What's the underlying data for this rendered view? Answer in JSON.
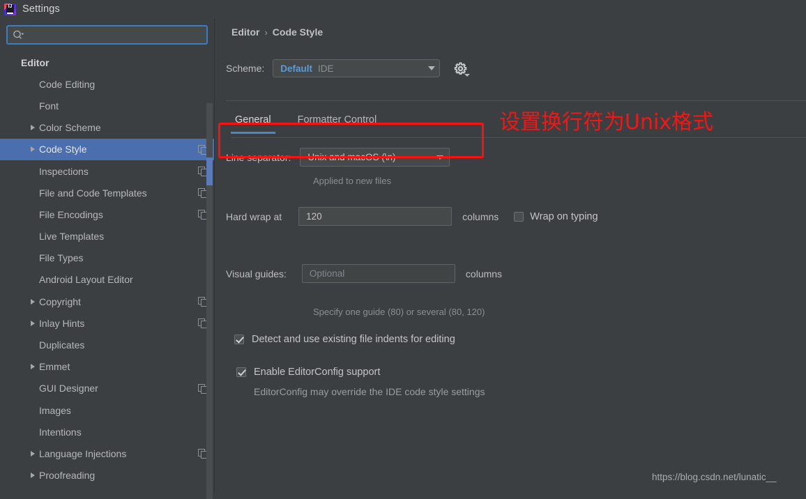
{
  "window": {
    "title": "Settings",
    "logo_icon": "intellij-idea-logo"
  },
  "sidebar": {
    "search": {
      "icon": "search-icon",
      "value": "",
      "placeholder": ""
    },
    "items": [
      {
        "label": "Editor",
        "indent": 0,
        "expandable": false,
        "group": true,
        "copy_icon": false,
        "selected": false
      },
      {
        "label": "Code Editing",
        "indent": 1,
        "expandable": false,
        "group": false,
        "copy_icon": false,
        "selected": false
      },
      {
        "label": "Font",
        "indent": 1,
        "expandable": false,
        "group": false,
        "copy_icon": false,
        "selected": false
      },
      {
        "label": "Color Scheme",
        "indent": 1,
        "expandable": true,
        "group": false,
        "copy_icon": false,
        "selected": false
      },
      {
        "label": "Code Style",
        "indent": 1,
        "expandable": true,
        "group": false,
        "copy_icon": true,
        "selected": true
      },
      {
        "label": "Inspections",
        "indent": 1,
        "expandable": false,
        "group": false,
        "copy_icon": true,
        "selected": false
      },
      {
        "label": "File and Code Templates",
        "indent": 1,
        "expandable": false,
        "group": false,
        "copy_icon": true,
        "selected": false
      },
      {
        "label": "File Encodings",
        "indent": 1,
        "expandable": false,
        "group": false,
        "copy_icon": true,
        "selected": false
      },
      {
        "label": "Live Templates",
        "indent": 1,
        "expandable": false,
        "group": false,
        "copy_icon": false,
        "selected": false
      },
      {
        "label": "File Types",
        "indent": 1,
        "expandable": false,
        "group": false,
        "copy_icon": false,
        "selected": false
      },
      {
        "label": "Android Layout Editor",
        "indent": 1,
        "expandable": false,
        "group": false,
        "copy_icon": false,
        "selected": false
      },
      {
        "label": "Copyright",
        "indent": 1,
        "expandable": true,
        "group": false,
        "copy_icon": true,
        "selected": false
      },
      {
        "label": "Inlay Hints",
        "indent": 1,
        "expandable": true,
        "group": false,
        "copy_icon": true,
        "selected": false
      },
      {
        "label": "Duplicates",
        "indent": 1,
        "expandable": false,
        "group": false,
        "copy_icon": false,
        "selected": false
      },
      {
        "label": "Emmet",
        "indent": 1,
        "expandable": true,
        "group": false,
        "copy_icon": false,
        "selected": false
      },
      {
        "label": "GUI Designer",
        "indent": 1,
        "expandable": false,
        "group": false,
        "copy_icon": true,
        "selected": false
      },
      {
        "label": "Images",
        "indent": 1,
        "expandable": false,
        "group": false,
        "copy_icon": false,
        "selected": false
      },
      {
        "label": "Intentions",
        "indent": 1,
        "expandable": false,
        "group": false,
        "copy_icon": false,
        "selected": false
      },
      {
        "label": "Language Injections",
        "indent": 1,
        "expandable": true,
        "group": false,
        "copy_icon": true,
        "selected": false
      },
      {
        "label": "Proofreading",
        "indent": 1,
        "expandable": true,
        "group": false,
        "copy_icon": false,
        "selected": false
      }
    ]
  },
  "main": {
    "breadcrumb": {
      "parent": "Editor",
      "separator": "›",
      "current": "Code Style"
    },
    "scheme": {
      "label": "Scheme:",
      "name": "Default",
      "kind": "IDE",
      "dropdown_icon": "chevron-down-icon",
      "gear_icon": "gear-icon"
    },
    "tabs": [
      {
        "label": "General",
        "active": true
      },
      {
        "label": "Formatter Control",
        "active": false
      }
    ],
    "line_separator": {
      "label": "Line separator:",
      "value": "Unix and macOS (\\n)",
      "dropdown_icon": "chevron-down-icon",
      "hint": "Applied to new files"
    },
    "hard_wrap": {
      "label": "Hard wrap at",
      "value": "120",
      "suffix": "columns",
      "wrap_on_typing_label": "Wrap on typing",
      "wrap_on_typing_checked": false
    },
    "visual_guides": {
      "label": "Visual guides:",
      "value": "",
      "placeholder": "Optional",
      "suffix": "columns",
      "hint": "Specify one guide (80) or several (80, 120)"
    },
    "checkboxes": [
      {
        "label": "Detect and use existing file indents for editing",
        "checked": true,
        "hint": ""
      },
      {
        "label": "Enable EditorConfig support",
        "checked": true,
        "hint": "EditorConfig may override the IDE code style settings"
      }
    ]
  },
  "annotations": {
    "highlight_color": "#fc1111",
    "note_text": "设置换行符为Unix格式",
    "watermark": "https://blog.csdn.net/lunatic__"
  }
}
